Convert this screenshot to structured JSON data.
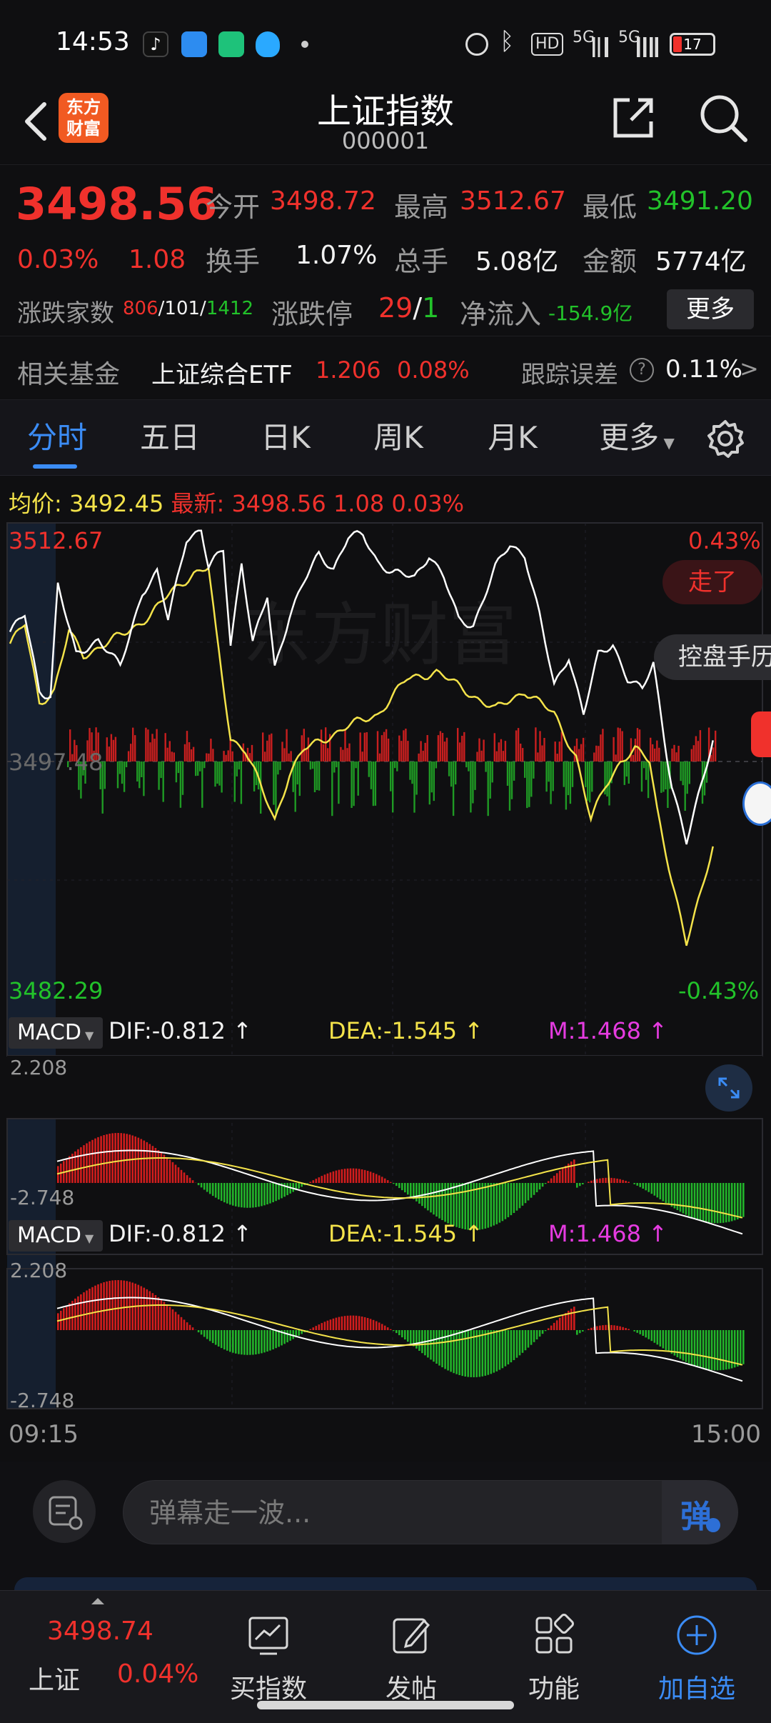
{
  "status_bar": {
    "time": "14:53",
    "battery": "17",
    "hd_label": "HD",
    "net1": "5G",
    "net2": "5G"
  },
  "header": {
    "logo_line1": "东方",
    "logo_line2": "财富",
    "title": "上证指数",
    "code": "000001"
  },
  "quote": {
    "price": "3498.56",
    "change_pct": "0.03%",
    "change": "1.08",
    "open_label": "今开",
    "open": "3498.72",
    "high_label": "最高",
    "high": "3512.67",
    "low_label": "最低",
    "low": "3491.20",
    "turnover_label": "换手",
    "turnover": "1.07%",
    "volume_label": "总手",
    "volume": "5.08亿",
    "amount_label": "金额",
    "amount": "5774亿",
    "breadth_label": "涨跌家数",
    "up": "806",
    "flat": "101",
    "down": "1412",
    "limit_label": "涨跌停",
    "limit_up": "29",
    "limit_down": "1",
    "inflow_label": "净流入",
    "inflow": "-154.9亿",
    "more_button": "更多"
  },
  "fund": {
    "label": "相关基金",
    "name": "上证综合ETF",
    "price": "1.206",
    "pct": "0.08%",
    "error_label": "跟踪误差",
    "error_value": "0.11%",
    "arrow": ">"
  },
  "tabs": [
    "分时",
    "五日",
    "日K",
    "周K",
    "月K",
    "更多"
  ],
  "chart": {
    "avg_label": "均价:",
    "avg_value": "3492.45",
    "latest_label": "最新:",
    "latest_value": "3498.56",
    "latest_change": "1.08",
    "latest_pct": "0.03%",
    "y_max": "3512.67",
    "y_mid": "3497.48",
    "y_min": "3482.29",
    "pct_max": "0.43%",
    "pct_min": "-0.43%",
    "watermark": "东方财富",
    "float_btn1": "走了",
    "float_btn2": "控盘手历",
    "time_start": "09:15",
    "time_end": "15:00"
  },
  "macd1": {
    "selector": "MACD",
    "dif": "DIF:-0.812",
    "dea": "DEA:-1.545",
    "m": "M:1.468",
    "max": "2.208",
    "min": "-2.748"
  },
  "macd2": {
    "selector": "MACD",
    "dif": "DIF:-0.812",
    "dea": "DEA:-1.545",
    "m": "M:1.468",
    "max": "2.208",
    "min": "-2.748"
  },
  "danmaku": {
    "placeholder": "弹幕走一波...",
    "button": "弹"
  },
  "bottom_nav": {
    "index_name": "上证",
    "index_price": "3498.74",
    "index_pct": "0.04%",
    "items": [
      "买指数",
      "发帖",
      "功能",
      "加自选"
    ]
  },
  "colors": {
    "up": "#f0312c",
    "down": "#22c22a",
    "price_line": "#ffffff",
    "avg_line": "#f4e34a",
    "accent": "#3b8cf5"
  }
}
